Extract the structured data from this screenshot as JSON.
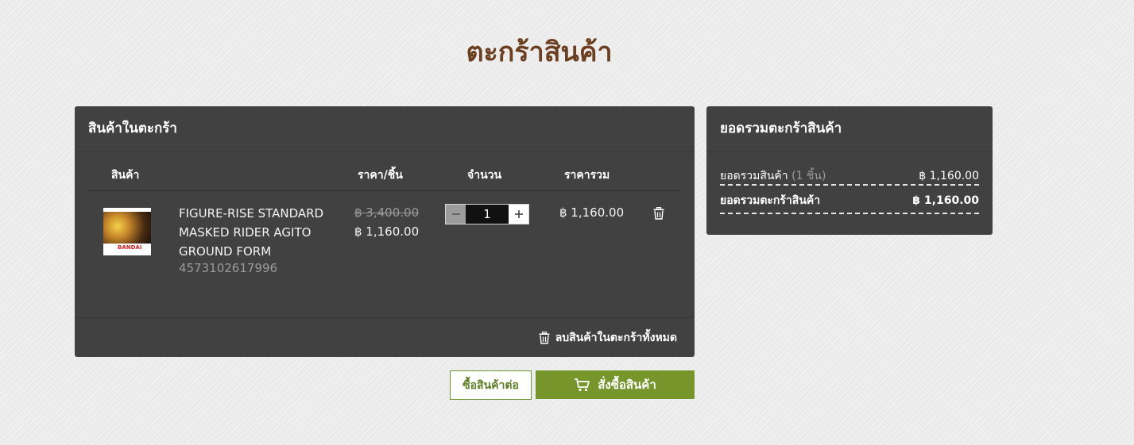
{
  "page": {
    "title": "ตะกร้าสินค้า"
  },
  "cart": {
    "header": "สินค้าในตะกร้า",
    "columns": {
      "product": "สินค้า",
      "unit_price": "ราคา/ชิ้น",
      "quantity": "จำนวน",
      "total": "ราคารวม"
    },
    "items": [
      {
        "name": "FIGURE-RISE STANDARD MASKED RIDER AGITO GROUND FORM",
        "sku": "4573102617996",
        "price_old": "฿ 3,400.00",
        "price_new": "฿ 1,160.00",
        "quantity": "1",
        "total": "฿ 1,160.00",
        "thumb_brand": "BANDAI"
      }
    ],
    "clear_all_label": "ลบสินค้าในตะกร้าทั้งหมด"
  },
  "summary": {
    "header": "ยอดรวมตะกร้าสินค้า",
    "subtotal_label": "ยอดรวมสินค้า",
    "subtotal_count": "(1 ชิ้น)",
    "subtotal_value": "฿ 1,160.00",
    "total_label": "ยอดรวมตะกร้าสินค้า",
    "total_value": "฿ 1,160.00"
  },
  "actions": {
    "continue_label": "ซื้อสินค้าต่อ",
    "checkout_label": "สั่งซื้อสินค้า"
  },
  "colors": {
    "title": "#6b3f1f",
    "panel": "#414141",
    "accent": "#76962c"
  }
}
